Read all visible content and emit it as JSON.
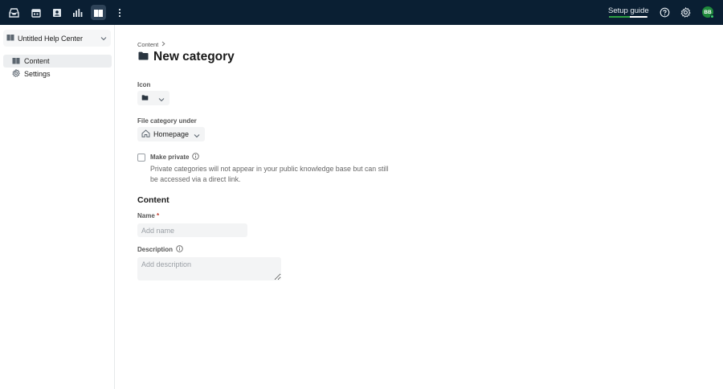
{
  "topbar": {
    "nav_icons": [
      {
        "name": "inbox-icon",
        "active": false
      },
      {
        "name": "calendar-icon",
        "active": false
      },
      {
        "name": "contacts-icon",
        "active": false
      },
      {
        "name": "reports-icon",
        "active": false
      },
      {
        "name": "knowledge-base-icon",
        "active": true
      },
      {
        "name": "more-vertical-icon",
        "active": false
      }
    ],
    "setup_guide_label": "Setup guide",
    "setup_progress": 0.55,
    "avatar_initials": "BB",
    "colors": {
      "background": "#0a1f33",
      "progress": "#2ea043",
      "avatar": "#1f8a3c"
    }
  },
  "sidebar": {
    "help_center_name": "Untitled Help Center",
    "items": [
      {
        "label": "Content",
        "icon": "book-icon",
        "active": true
      },
      {
        "label": "Settings",
        "icon": "gear-icon",
        "active": false
      }
    ]
  },
  "main": {
    "breadcrumb": "Content",
    "page_title": "New category",
    "icon_label": "Icon",
    "file_under_label": "File category under",
    "file_under_value": "Homepage",
    "make_private_label": "Make private",
    "make_private_desc": "Private categories will not appear in your public knowledge base but can still be accessed via a direct link.",
    "make_private_checked": false,
    "content_section": "Content",
    "name_label": "Name",
    "name_required": "*",
    "name_placeholder": "Add name",
    "name_value": "",
    "description_label": "Description",
    "description_placeholder": "Add description",
    "description_value": ""
  }
}
